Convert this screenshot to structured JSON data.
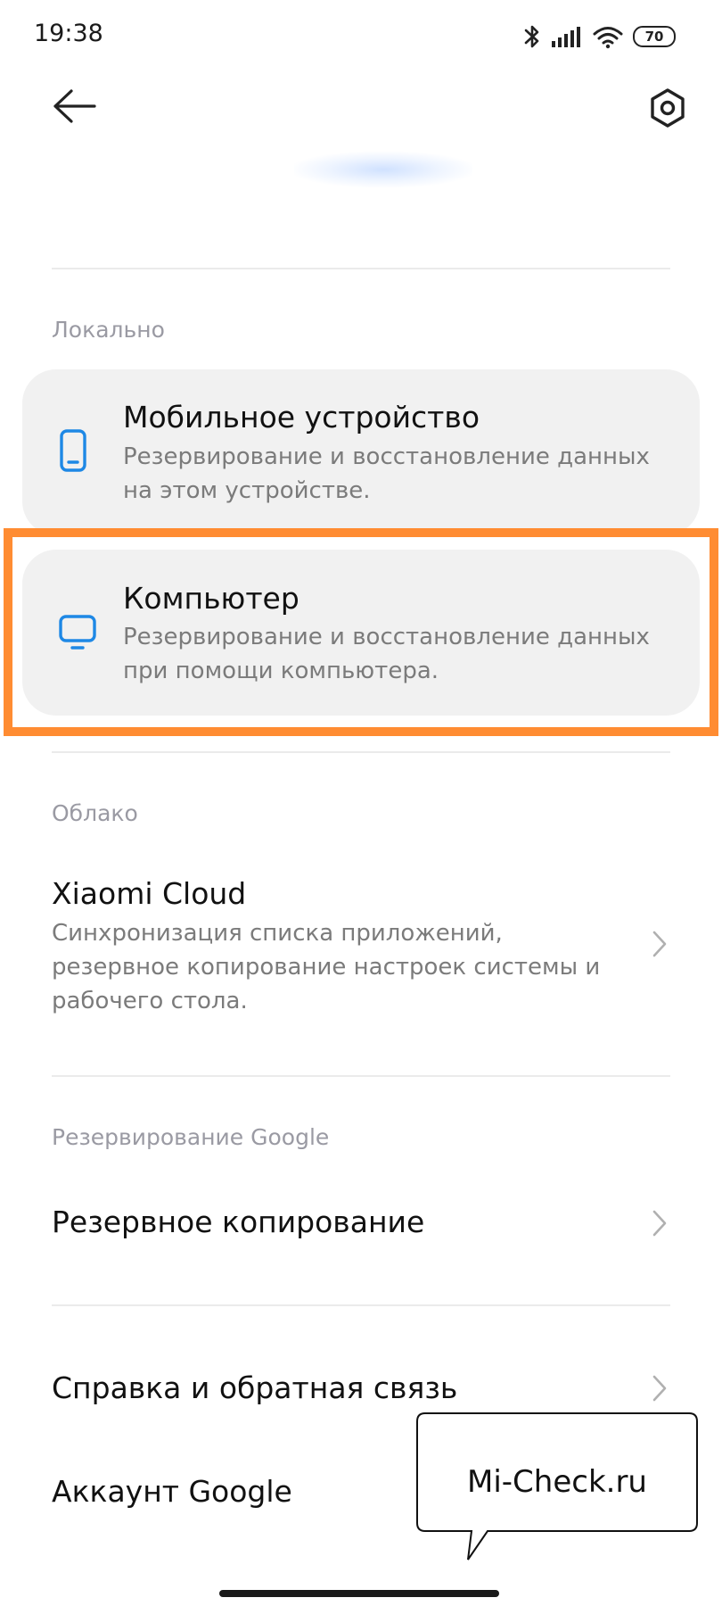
{
  "status_bar": {
    "time": "19:38",
    "battery": "70",
    "icons": [
      "bluetooth-icon",
      "signal-icon",
      "wifi-icon",
      "battery-icon"
    ]
  },
  "header": {
    "back_icon": "arrow-left-icon",
    "settings_icon": "hexagon-settings-icon"
  },
  "sections": {
    "local": {
      "header": "Локально",
      "items": [
        {
          "icon": "phone-icon",
          "title": "Мобильное устройство",
          "subtitle": "Резервирование и восстановление данных на этом устройстве."
        },
        {
          "icon": "monitor-icon",
          "title": "Компьютер",
          "subtitle": "Резервирование и восстановление данных при помощи компьютера."
        }
      ]
    },
    "cloud": {
      "header": "Облако",
      "items": [
        {
          "title": "Xiaomi Cloud",
          "subtitle": "Синхронизация списка приложений, резервное копирование настроек системы и рабочего стола."
        }
      ]
    },
    "google": {
      "header": "Резервирование Google",
      "items": [
        {
          "title": "Резервное копирование"
        }
      ]
    },
    "other": {
      "items": [
        {
          "title": "Справка и обратная связь"
        },
        {
          "title": "Аккаунт Google"
        }
      ]
    }
  },
  "watermark": {
    "text": "Mi-Check.ru"
  },
  "colors": {
    "accent_blue": "#1e88e5",
    "highlight_orange": "#ff8c32",
    "card_bg": "#f1f1f1",
    "section_header": "#9a9aa3",
    "subtitle": "#7b7b7b"
  }
}
